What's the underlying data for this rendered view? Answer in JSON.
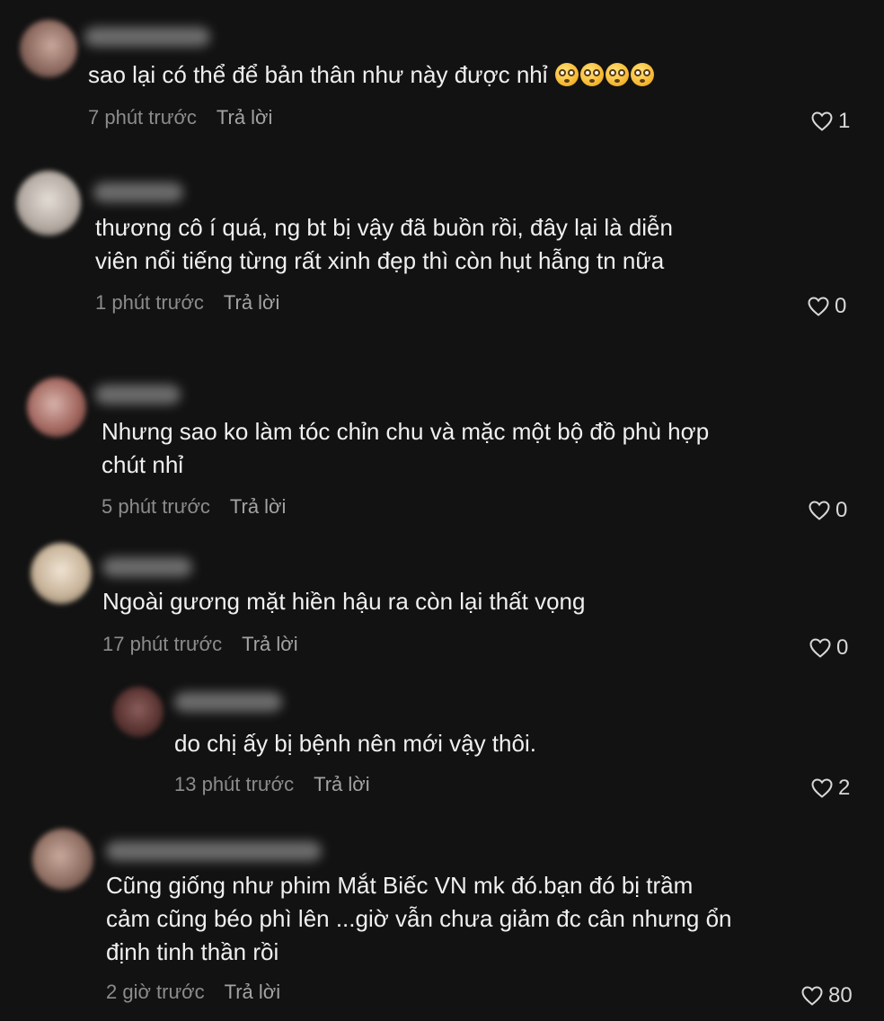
{
  "comments": [
    {
      "text_lines": [
        "sao lại có thể để bản thân như này được nhỉ"
      ],
      "emoji": [
        "flushed-face-emoji",
        "flushed-face-emoji",
        "flushed-face-emoji",
        "flushed-face-emoji"
      ],
      "time": "7 phút trước",
      "reply_label": "Trả lời",
      "likes": "1"
    },
    {
      "text_lines": [
        "thương cô í quá, ng bt bị vậy đã buồn rồi, đây lại là diễn",
        "viên nổi tiếng từng rất xinh đẹp thì còn hụt hẫng tn nữa"
      ],
      "time": "1 phút trước",
      "reply_label": "Trả lời",
      "likes": "0"
    },
    {
      "text_lines": [
        "Nhưng sao ko làm tóc chỉn chu và mặc một bộ đồ phù hợp",
        "chút nhỉ"
      ],
      "time": "5 phút trước",
      "reply_label": "Trả lời",
      "likes": "0"
    },
    {
      "text_lines": [
        "Ngoài gương mặt hiền hậu ra còn lại thất vọng"
      ],
      "time": "17 phút trước",
      "reply_label": "Trả lời",
      "likes": "0"
    },
    {
      "text_lines": [
        "do chị ấy bị bệnh nên mới vậy thôi."
      ],
      "time": "13 phút trước",
      "reply_label": "Trả lời",
      "likes": "2"
    },
    {
      "text_lines": [
        "Cũng giống như phim Mắt Biếc VN mk đó.bạn đó bị trầm",
        "cảm cũng béo phì lên ...giờ vẫn chưa giảm đc cân nhưng ổn",
        "định tinh thần rồi"
      ],
      "time": "2 giờ trước",
      "reply_label": "Trả lời",
      "likes": "80"
    }
  ],
  "colors": {
    "background": "#121212",
    "text": "#f0f0f0",
    "meta": "#8c8c8c"
  },
  "icons": {
    "like": "heart-outline-icon"
  }
}
